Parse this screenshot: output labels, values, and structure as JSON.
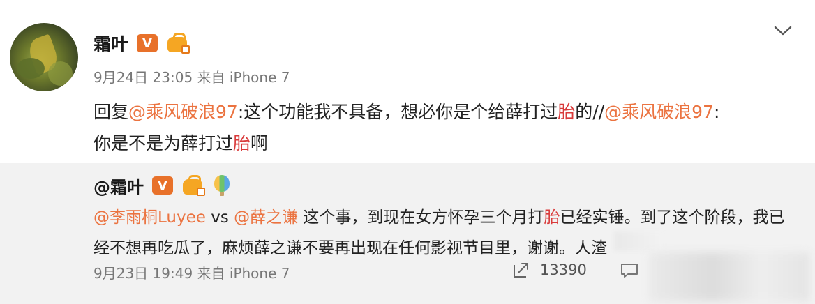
{
  "post": {
    "username": "霜叶",
    "verified_label": "V",
    "timestamp": "9月24日 23:05",
    "source": "来自 iPhone 7",
    "content": {
      "prefix": "回复",
      "mention1": "@乘风破浪97",
      "text1": ":这个功能我不具备，想必你是个给薛打过",
      "hl1": "胎",
      "text2": "的//",
      "mention2": "@乘风破浪97",
      "text3": ":",
      "text4": "你是不是为薛打过",
      "hl2": "胎",
      "text5": "啊"
    }
  },
  "quoted": {
    "username": "@霜叶",
    "verified_label": "V",
    "content": {
      "mention1": "@李雨桐Luyee",
      "vs": " vs ",
      "mention2": "@薛之谦",
      "text1": " 这个事，到现在女方怀孕三个月打",
      "hl1": "胎",
      "text2": "已经实锤。到了这个阶段，我已经不想再吃瓜了，麻烦薛之谦不要再出现在任何影视节目里，谢谢。人渣"
    },
    "timestamp": "9月23日 19:49",
    "source": "来自 iPhone 7",
    "repost_count": "13390"
  },
  "colors": {
    "mention": "#eb7340",
    "highlight": "#d93a3a",
    "verified_badge": "#e8712a",
    "quoted_bg": "#f2f2f2"
  },
  "icons": [
    "chevron-down-icon",
    "verified-v-icon",
    "level-badge-icon",
    "balloon-icon",
    "repost-icon",
    "comment-icon"
  ]
}
